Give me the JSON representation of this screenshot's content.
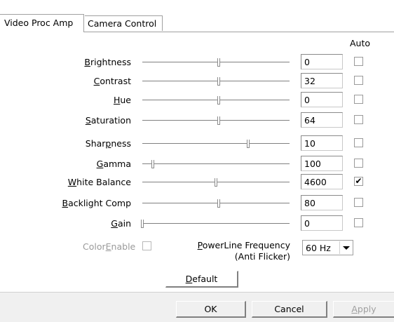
{
  "tabs": [
    {
      "label": "Video Proc Amp",
      "active": true
    },
    {
      "label": "Camera Control",
      "active": false
    }
  ],
  "auto_header": "Auto",
  "controls": [
    {
      "pre": "",
      "key": "B",
      "post": "rightness",
      "value": "0",
      "level": 0.52,
      "auto": false
    },
    {
      "pre": "",
      "key": "C",
      "post": "ontrast",
      "value": "32",
      "level": 0.52,
      "auto": false
    },
    {
      "pre": "",
      "key": "H",
      "post": "ue",
      "value": "0",
      "level": 0.52,
      "auto": false
    },
    {
      "pre": "",
      "key": "S",
      "post": "aturation",
      "value": "64",
      "level": 0.52,
      "auto": false
    },
    {
      "pre": "Shar",
      "key": "p",
      "post": "ness",
      "value": "10",
      "level": 0.72,
      "auto": false
    },
    {
      "pre": "",
      "key": "G",
      "post": "amma",
      "value": "100",
      "level": 0.07,
      "auto": false
    },
    {
      "pre": "",
      "key": "W",
      "post": "hite Balance",
      "value": "4600",
      "level": 0.5,
      "auto": true
    },
    {
      "pre": "",
      "key": "B",
      "post": "acklight Comp",
      "value": "80",
      "level": 0.52,
      "auto": false
    },
    {
      "pre": "",
      "key": "G",
      "post": "ain",
      "value": "0",
      "level": 0.0,
      "auto": false
    }
  ],
  "color_enable": {
    "pre": "Color",
    "key": "E",
    "post": "nable",
    "checked": false
  },
  "powerline": {
    "pre": "",
    "key": "P",
    "post": "owerLine Frequency",
    "line2": "(Anti Flicker)",
    "value": "60 Hz"
  },
  "buttons": {
    "default": {
      "pre": "",
      "key": "D",
      "post": "efault"
    },
    "ok": "OK",
    "cancel": "Cancel",
    "apply": {
      "pre": "",
      "key": "A",
      "post": "pply"
    }
  }
}
